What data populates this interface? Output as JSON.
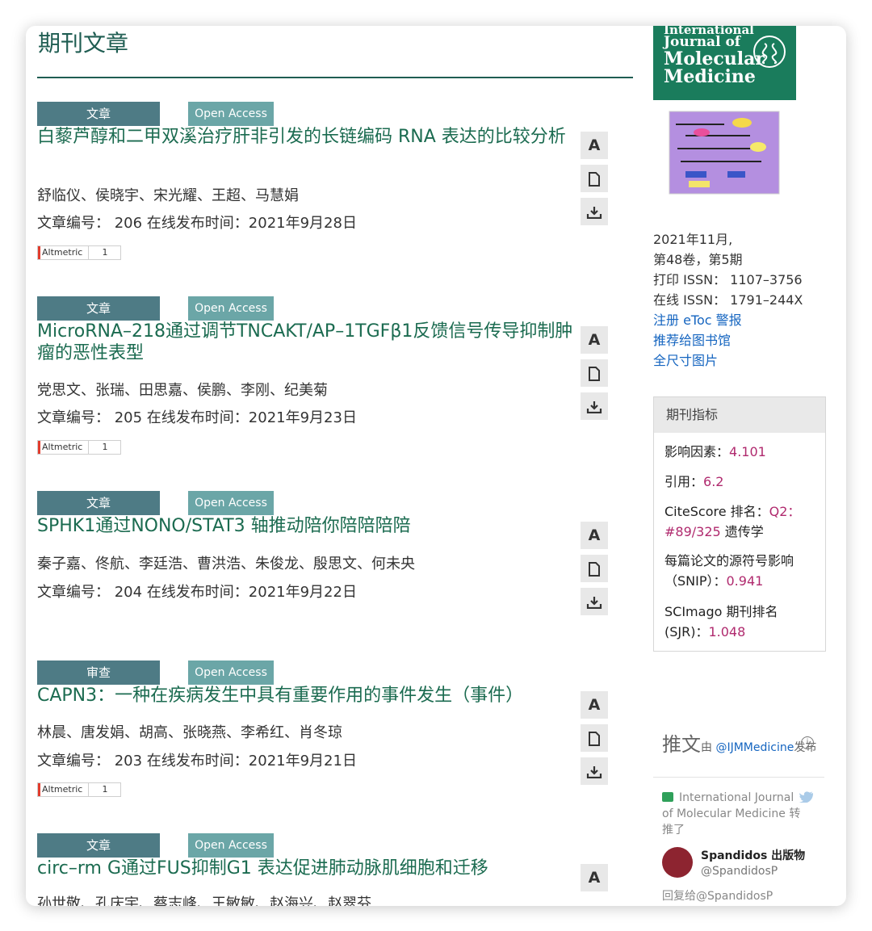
{
  "page_title": "期刊文章",
  "articles": [
    {
      "type": "文章",
      "access": "Open Access",
      "title": "白藜芦醇和二甲双溪治疗肝非引发的长链编码 RNA 表达的比较分析",
      "authors": "舒临仪、侯晓宇、宋光耀、王超、马慧娟",
      "meta": "文章编号： 206 在线发布时间：2021年9月28日",
      "altmetric": "Altmetric",
      "altmetric_count": "1"
    },
    {
      "type": "文章",
      "access": "Open Access",
      "title": "MicroRNA–218通过调节TNCAKT/AP–1TGFβ1反馈信号传导抑制肿瘤的恶性表型",
      "authors": "党思文、张瑞、田思嘉、侯鹏、李刚、纪美菊",
      "meta": "文章编号： 205 在线发布时间：2021年9月23日",
      "altmetric": "Altmetric",
      "altmetric_count": "1"
    },
    {
      "type": "文章",
      "access": "Open Access",
      "title": "SPHK1通过NONO/STAT3 轴推动陪你陪陪陪陪",
      "authors": "秦子嘉、佟航、李廷浩、曹洪浩、朱俊龙、殷思文、何未央",
      "meta": "文章编号： 204 在线发布时间：2021年9月22日"
    },
    {
      "type": "审查",
      "access": "Open Access",
      "title": "CAPN3：一种在疾病发生中具有重要作用的事件发生（事件）",
      "authors": "林晨、唐发娟、胡高、张晓燕、李希红、肖冬琼",
      "meta": "文章编号： 203 在线发布时间：2021年9月21日",
      "altmetric": "Altmetric",
      "altmetric_count": "1"
    },
    {
      "type": "文章",
      "access": "Open Access",
      "title": "circ–rm G通过FUS抑制G1 表达促进肺动脉肌细胞和迁移",
      "authors": "孙世敬、孔庆宇、蔡志峰、王敏敏、赵海兴、赵翠芬"
    }
  ],
  "tools": {
    "text_icon_label": "A",
    "pdf_icon": "document-icon",
    "download_icon": "download-icon"
  },
  "cover": {
    "line1": "International",
    "line2": "Journal of",
    "line3": "Molecular",
    "line4": "Medicine"
  },
  "issue": {
    "date": "2021年11月,",
    "volume": "第48卷，第5期",
    "print_issn": "打印 ISSN： 1107–3756",
    "online_issn": "在线 ISSN： 1791–244X"
  },
  "links": {
    "etoc": "注册 eToc 警报",
    "library": "推荐给图书馆",
    "fullsize": "全尺寸图片"
  },
  "metrics": {
    "header": "期刊指标",
    "impact_label": "影响因素：",
    "impact_value": "4.101",
    "citation_label": "引用：",
    "citation_value": "6.2",
    "citescore_label": "CiteScore 排名：",
    "citescore_value_1": "Q2：",
    "citescore_value_2": "#89/325",
    "citescore_field": " 遗传学",
    "snip_label_1": "每篇论文的源符号影响",
    "snip_label_2": "（SNIP）：",
    "snip_value": "0.941",
    "sjr_label_1": "SCImago 期刊排名",
    "sjr_label_2": "(SJR)：",
    "sjr_value": "1.048"
  },
  "tweets": {
    "title": "推文",
    "by_prefix": "由 ",
    "handle": "@IJMMedicine",
    "by_suffix": "发布",
    "rt_text": "International Journal of Molecular Medicine 转推了",
    "author_name": "Spandidos 出版物",
    "author_handle": "@SpandidosP",
    "reply": "回复给@SpandidosP"
  },
  "colors": {
    "accent": "#1f5d52",
    "type_tag": "#4e7b85",
    "oa_tag": "#6ba6a7",
    "metric_value": "#b02a6e",
    "link": "#1565c0"
  }
}
